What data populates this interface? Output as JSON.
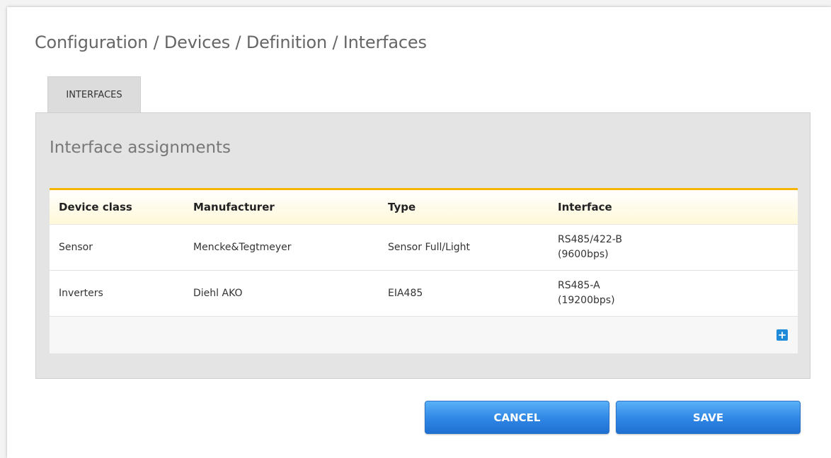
{
  "breadcrumb": "Configuration / Devices / Definition / Interfaces",
  "tabs": [
    {
      "label": "INTERFACES"
    }
  ],
  "panel": {
    "title": "Interface assignments",
    "table": {
      "columns": [
        "Device class",
        "Manufacturer",
        "Type",
        "Interface"
      ],
      "rows": [
        {
          "device_class": "Sensor",
          "manufacturer": "Mencke&Tegtmeyer",
          "type": "Sensor Full/Light",
          "interface_line1": "RS485/422-B",
          "interface_line2": "(9600bps)"
        },
        {
          "device_class": "Inverters",
          "manufacturer": "Diehl AKO",
          "type": "EIA485",
          "interface_line1": "RS485-A",
          "interface_line2": "(19200bps)"
        }
      ],
      "add_icon": "plus-icon"
    }
  },
  "buttons": {
    "cancel": "CANCEL",
    "save": "SAVE"
  },
  "colors": {
    "accent_header_border": "#f4b400",
    "button_blue": "#2f86e4",
    "add_button": "#1f8ad9"
  }
}
